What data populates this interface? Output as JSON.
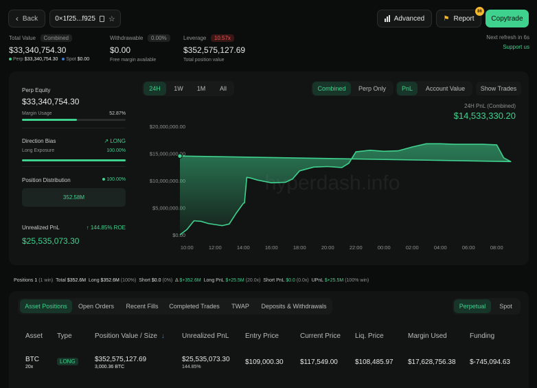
{
  "header": {
    "back_label": "Back",
    "address": "0×1f25...f925",
    "advanced_label": "Advanced",
    "report_label": "Report",
    "report_badge": "86",
    "copytrade_label": "Copytrade",
    "refresh_text": "Next refresh in 6s",
    "support_label": "Support us"
  },
  "summary": {
    "total_value_label": "Total Value",
    "combined_tag": "Combined",
    "total_value": "$33,340,754.30",
    "perp_label": "Perp",
    "perp_value": "$33,340,754.30",
    "spot_label": "Spot",
    "spot_value": "$0.00",
    "withdrawable_label": "Withdrawable",
    "withdrawable_pct": "0.00%",
    "withdrawable_value": "$0.00",
    "free_margin_label": "Free margin available",
    "leverage_label": "Leverage",
    "leverage_tag": "10.57x",
    "leverage_value": "$352,575,127.69",
    "total_position_label": "Total position value"
  },
  "stats": {
    "perp_equity_label": "Perp Equity",
    "perp_equity_value": "$33,340,754.30",
    "margin_usage_label": "Margin Usage",
    "margin_usage_value": "52.87%",
    "margin_usage_fraction": 0.5287,
    "direction_bias_label": "Direction Bias",
    "direction_value": "LONG",
    "long_exposure_label": "Long Exposure",
    "long_exposure_value": "100.00%",
    "long_exposure_fraction": 1.0,
    "position_distribution_label": "Position Distribution",
    "position_distribution_pct": "100.00%",
    "position_distribution_amount": "352.58M",
    "unrealized_pnl_label": "Unrealized PnL",
    "roe_value": "144.85% ROE",
    "unrealized_pnl_value": "$25,535,073.30"
  },
  "chart_controls": {
    "timeframes": [
      "24H",
      "1W",
      "1M",
      "All"
    ],
    "scope": [
      "Combined",
      "Perp Only"
    ],
    "metric": [
      "PnL",
      "Account Value"
    ],
    "show_trades_label": "Show Trades",
    "pnl_title": "24H PnL (Combined)",
    "pnl_value": "$14,533,330.20"
  },
  "watermark": "hyperdash.info",
  "chart_data": {
    "type": "area",
    "x": [
      "09:30",
      "10:00",
      "10:30",
      "11:00",
      "11:30",
      "12:00",
      "12:30",
      "13:00",
      "13:30",
      "14:00",
      "14:05",
      "14:15",
      "14:30",
      "15:00",
      "16:00",
      "17:00",
      "17:30",
      "18:00",
      "19:00",
      "20:00",
      "21:00",
      "21:30",
      "22:00",
      "23:00",
      "00:00",
      "01:00",
      "02:00",
      "03:00",
      "04:00",
      "05:00",
      "06:00",
      "07:00",
      "08:00",
      "08:30",
      "09:00",
      "09:30"
    ],
    "series": [
      {
        "values": [
          0.0,
          1.0,
          2.6,
          2.5,
          2.1,
          1.9,
          1.7,
          2.0,
          4.0,
          5.8,
          5.9,
          10.6,
          10.5,
          10.1,
          9.6,
          9.7,
          10.3,
          11.8,
          12.5,
          12.6,
          12.4,
          13.2,
          15.3,
          15.6,
          15.4,
          15.5,
          16.2,
          16.8,
          16.8,
          16.7,
          16.7,
          16.7,
          16.6,
          14.2,
          13.5,
          14.53
        ]
      }
    ],
    "y_unit": "millions USD",
    "ylim": [
      0,
      20
    ],
    "y_ticks": [
      "$0.00",
      "$5,000,000.00",
      "$10,000,000.00",
      "$15,000,000.00",
      "$20,000,000.00"
    ],
    "x_ticks": [
      "10:00",
      "12:00",
      "14:00",
      "16:00",
      "18:00",
      "20:00",
      "22:00",
      "00:00",
      "02:00",
      "04:00",
      "06:00",
      "08:00"
    ],
    "grid": false,
    "color": "#3fd28f"
  },
  "positions_bar": {
    "positions_label": "Positions",
    "positions_count": "1",
    "positions_win": "(1 win)",
    "total_label": "Total",
    "total_value": "$352.6M",
    "long_label": "Long",
    "long_value": "$352.6M",
    "long_pct": "(100%)",
    "short_label": "Short",
    "short_value": "$0.0",
    "short_pct": "(0%)",
    "delta_label": "Δ",
    "delta_value": "$+352.6M",
    "long_pnl_label": "Long PnL",
    "long_pnl_value": "$+25.5M",
    "long_pnl_lev": "(20.0x)",
    "short_pnl_label": "Short PnL",
    "short_pnl_value": "$0.0",
    "short_pnl_lev": "(0.0x)",
    "upnl_label": "UPnL",
    "upnl_value": "$+25.5M",
    "upnl_win": "(100% win)"
  },
  "tabs": [
    "Asset Positions",
    "Open Orders",
    "Recent Fills",
    "Completed Trades",
    "TWAP",
    "Deposits & Withdrawals"
  ],
  "market_toggle": [
    "Perpetual",
    "Spot"
  ],
  "table": {
    "headers": [
      "Asset",
      "Type",
      "Position Value / Size",
      "Unrealized PnL",
      "Entry Price",
      "Current Price",
      "Liq. Price",
      "Margin Used",
      "Funding"
    ],
    "sort_icon": "↓",
    "rows": [
      {
        "asset": "BTC",
        "leverage": "20x",
        "type": "LONG",
        "position_value": "$352,575,127.69",
        "size": "3,000.36 BTC",
        "pnl": "$25,535,073.30",
        "pnl_pct": "144.85%",
        "entry": "$109,000.30",
        "current": "$117,549.00",
        "liq": "$108,485.97",
        "margin": "$17,628,756.38",
        "funding": "$-745,094.63"
      }
    ]
  }
}
